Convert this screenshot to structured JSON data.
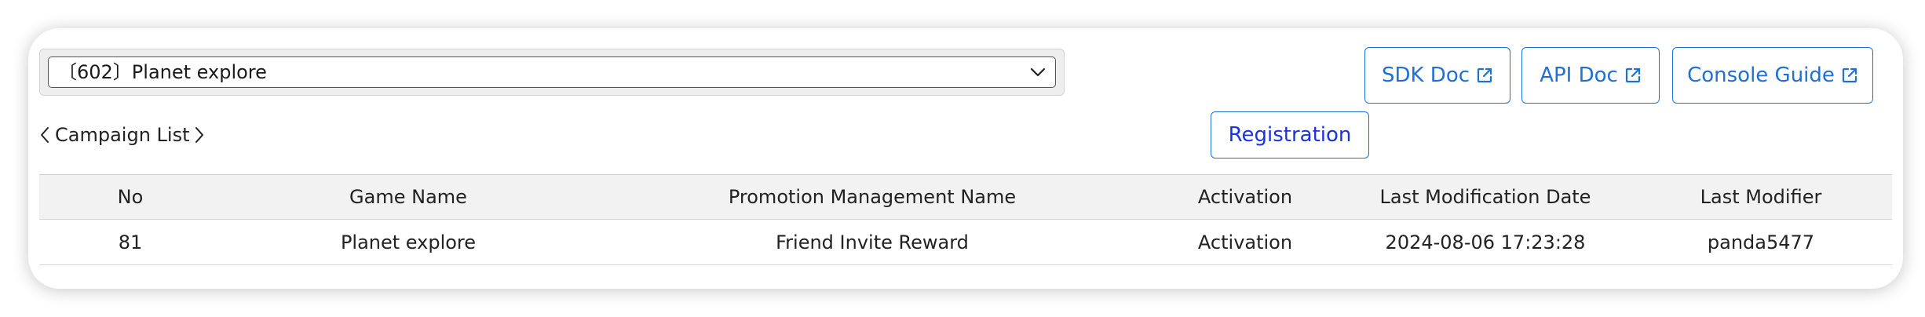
{
  "campaign_select": {
    "selected": "〔602〕Planet explore"
  },
  "doc_buttons": [
    {
      "label": "SDK Doc",
      "icon": "external-link-icon"
    },
    {
      "label": "API Doc",
      "icon": "external-link-icon"
    },
    {
      "label": "Console Guide",
      "icon": "external-link-icon"
    }
  ],
  "campaign_nav": {
    "label": "Campaign List",
    "prev_icon": "chevron-left-icon",
    "next_icon": "chevron-right-icon"
  },
  "registration_label": "Registration",
  "table": {
    "headers": [
      "No",
      "Game Name",
      "Promotion Management Name",
      "Activation",
      "Last Modification Date",
      "Last Modifier"
    ],
    "rows": [
      [
        "81",
        "Planet explore",
        "Friend Invite Reward",
        "Activation",
        "2024-08-06 17:23:28",
        "panda5477"
      ]
    ]
  },
  "colors": {
    "accent": "#1f6fd6",
    "registration_text": "#1a33e0",
    "header_bg": "#f2f2f2"
  }
}
